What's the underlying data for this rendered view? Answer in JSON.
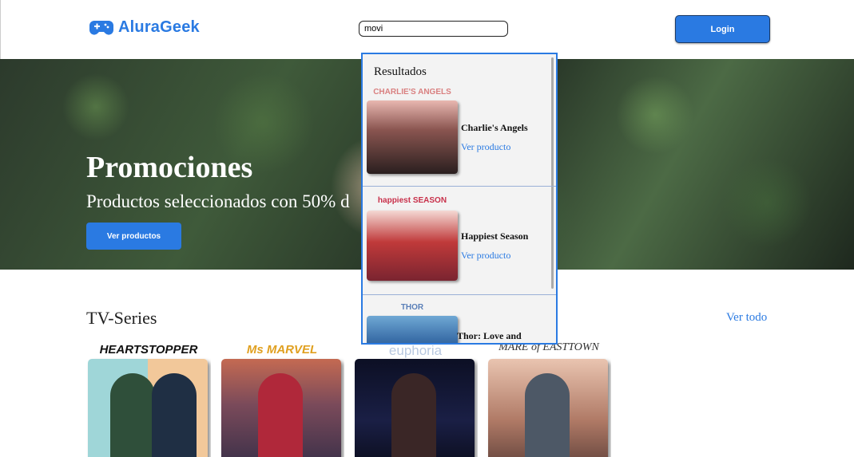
{
  "header": {
    "brand": "AluraGeek",
    "search_value": "movi",
    "login_label": "Login"
  },
  "hero": {
    "title": "Promociones",
    "subtitle": "Productos seleccionados con 50% d",
    "button_label": "Ver productos"
  },
  "results": {
    "title": "Resultados",
    "items": [
      {
        "name": "Charlie's Angels",
        "link": "Ver producto",
        "thumb_label": "CHARLIE'S ANGELS"
      },
      {
        "name": "Happiest Season",
        "link": "Ver producto",
        "thumb_label": "happiest SEASON"
      },
      {
        "name": "Thor: Love and",
        "link": "",
        "thumb_label": "THOR"
      }
    ]
  },
  "section": {
    "title": "TV-Series",
    "see_all": "Ver todo",
    "cards": [
      {
        "title": "HEARTSTOPPER"
      },
      {
        "title": "Ms MARVEL"
      },
      {
        "title": "euphoria"
      },
      {
        "title": "MARE of EASTTOWN"
      }
    ]
  },
  "colors": {
    "accent": "#2a7ae2",
    "button_border": "#1a3a66"
  }
}
